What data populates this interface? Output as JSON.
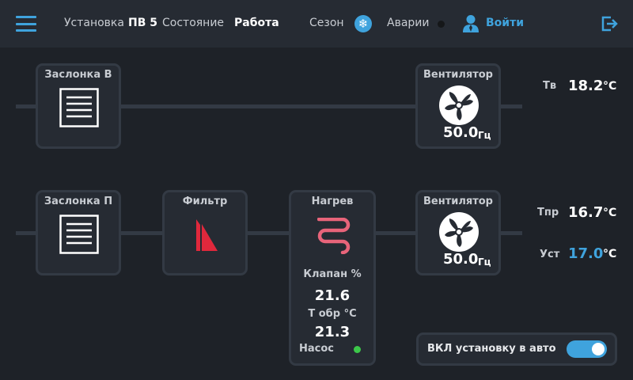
{
  "header": {
    "unit_label": "Установка",
    "unit_value": "ПВ 5",
    "state_label": "Состояние",
    "state_value": "Работа",
    "season_label": "Сезон",
    "season_icon": "snowflake-icon",
    "alarms_label": "Аварии",
    "login_label": "Войти"
  },
  "exhaust": {
    "damper_title": "Заслонка В",
    "fan_title": "Вентилятор",
    "fan_value": "50.0",
    "fan_unit": "Гц",
    "temp_label": "Тв",
    "temp_value": "18.2",
    "temp_unit": "°С"
  },
  "supply": {
    "damper_title": "Заслонка П",
    "filter_title": "Фильтр",
    "heater_title": "Нагрев",
    "valve_label": "Клапан %",
    "valve_value": "21.6",
    "return_temp_label": "Т обр °С",
    "return_temp_value": "21.3",
    "pump_label": "Насос",
    "fan_title": "Вентилятор",
    "fan_value": "50.0",
    "fan_unit": "Гц",
    "temp_label": "Тпр",
    "temp_value": "16.7",
    "temp_unit": "°С",
    "setpoint_label": "Уст",
    "setpoint_value": "17.0",
    "setpoint_unit": "°С"
  },
  "auto": {
    "label": "ВКЛ установку в авто",
    "enabled": true
  },
  "colors": {
    "accent": "#3fa3dd",
    "background": "#1e2228",
    "panel": "#262b33",
    "pump_ok": "#3cc84a",
    "heater": "#e8647a",
    "filter": "#e0283c"
  }
}
